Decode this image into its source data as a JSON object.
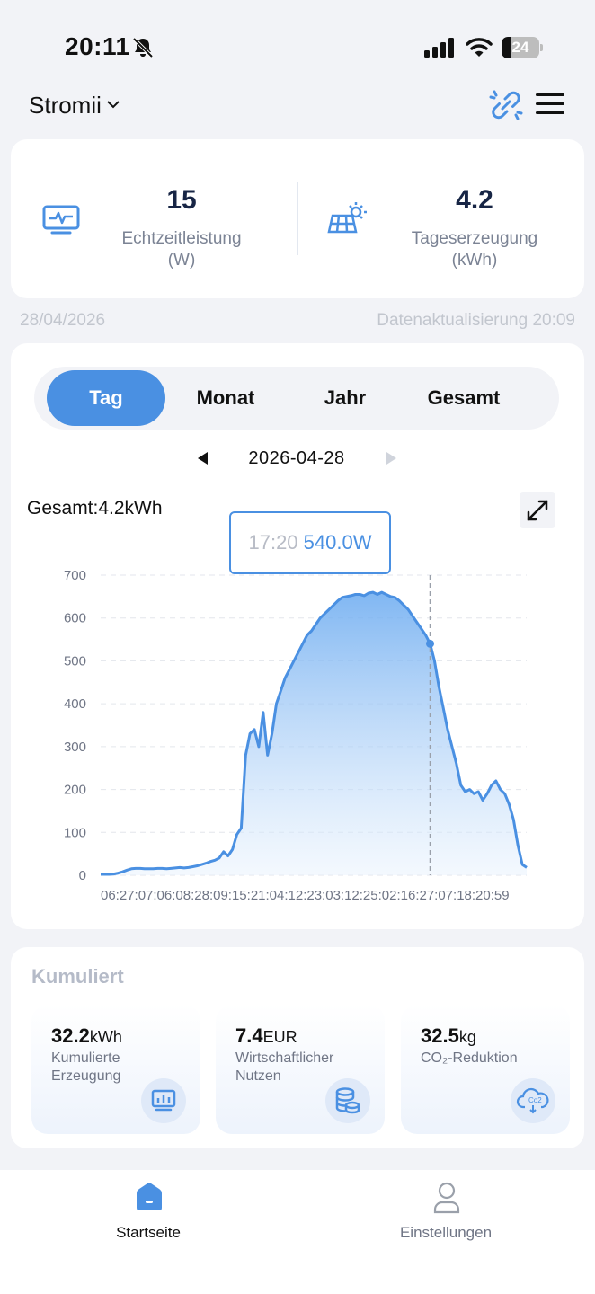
{
  "status_bar": {
    "time": "20:11",
    "battery": "24",
    "battery_level": 0.24
  },
  "header": {
    "title": "Stromii"
  },
  "realtime": {
    "value": "15",
    "label": "Echtzeitleistung",
    "unit": "(W)"
  },
  "daily": {
    "value": "4.2",
    "label": "Tageserzeugung",
    "unit": "(kWh)"
  },
  "date_info": {
    "date": "28/04/2026",
    "updated": "Datenaktualisierung 20:09"
  },
  "period_tabs": [
    "Tag",
    "Monat",
    "Jahr",
    "Gesamt"
  ],
  "active_tab": "Tag",
  "chart_nav": {
    "date": "2026-04-28"
  },
  "chart_total": "Gesamt:4.2kWh",
  "tooltip": {
    "time": "17:20",
    "value": "540.0W"
  },
  "chart_data": {
    "type": "area",
    "x_tick_text": "06:27:07:06:08:28:09:15:21:04:12:23:03:12:25:02:16:27:07:18:20:59",
    "ylim": [
      0,
      700
    ],
    "y_ticks": [
      "0",
      "100",
      "200",
      "300",
      "400",
      "500",
      "600",
      "700"
    ],
    "grid": true,
    "color": "#4a90e2",
    "highlight_time": "17:20",
    "highlight_value": 540,
    "series": [
      {
        "values": [
          2,
          2,
          2,
          3,
          5,
          8,
          12,
          15,
          16,
          16,
          15,
          15,
          15,
          16,
          16,
          15,
          16,
          17,
          18,
          17,
          18,
          20,
          22,
          25,
          28,
          32,
          35,
          40,
          55,
          45,
          60,
          95,
          110,
          280,
          330,
          340,
          300,
          380,
          280,
          330,
          400,
          430,
          460,
          480,
          500,
          520,
          540,
          560,
          570,
          585,
          600,
          610,
          620,
          630,
          640,
          648,
          650,
          652,
          655,
          655,
          652,
          658,
          660,
          655,
          660,
          655,
          650,
          648,
          640,
          630,
          620,
          605,
          590,
          575,
          560,
          540,
          500,
          440,
          390,
          340,
          300,
          260,
          210,
          195,
          200,
          190,
          195,
          175,
          190,
          210,
          220,
          200,
          190,
          165,
          130,
          70,
          25,
          18
        ]
      }
    ]
  },
  "cumulative": {
    "title": "Kumuliert",
    "items": [
      {
        "value": "32.2",
        "unit": "kWh",
        "label1": "Kumulierte",
        "label2": "Erzeugung"
      },
      {
        "value": "7.4",
        "unit": "EUR",
        "label1": "Wirtschaftlicher",
        "label2": "Nutzen"
      },
      {
        "value": "32.5",
        "unit": "kg",
        "label1": "CO₂-Reduktion",
        "label2": ""
      }
    ]
  },
  "co2_icon_text": "Co2",
  "tabbar": {
    "home": "Startseite",
    "settings": "Einstellungen"
  },
  "icons": {
    "bell": "bell-slash-icon",
    "signal": "signal-icon",
    "wifi": "wifi-icon",
    "link": "unlink-icon",
    "menu": "hamburger-icon",
    "monitor": "monitor-pulse-icon",
    "solar": "solar-panel-icon",
    "expand": "expand-icon",
    "home": "home-icon",
    "user": "user-icon"
  },
  "colors": {
    "accent": "#4a90e2",
    "dark": "#172545",
    "muted": "#7b8394"
  }
}
